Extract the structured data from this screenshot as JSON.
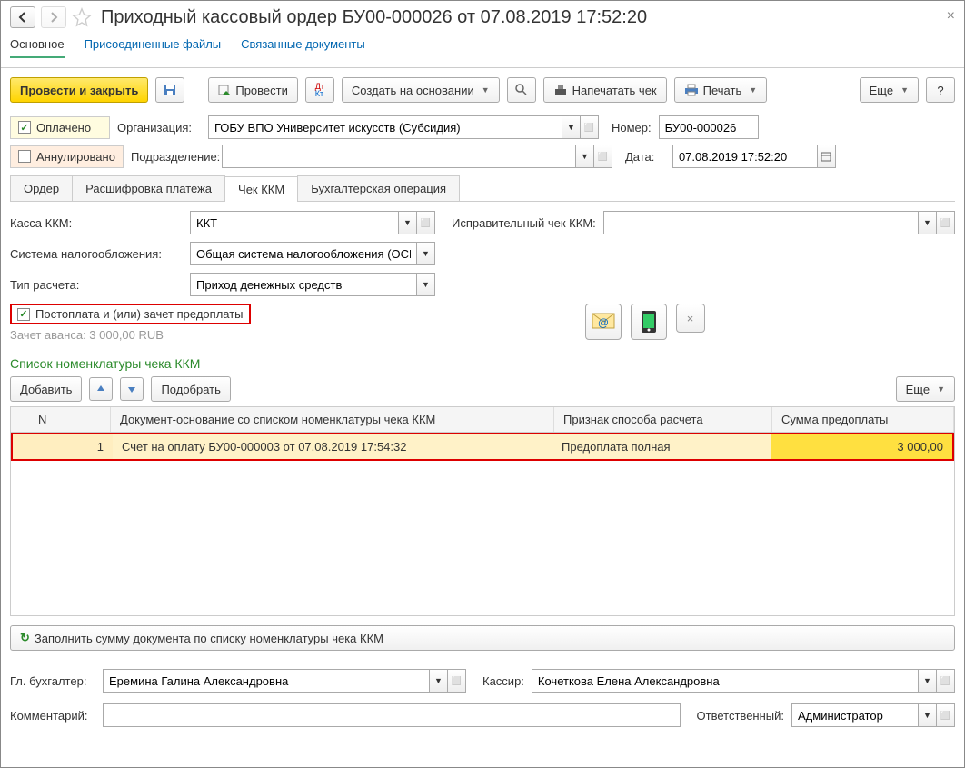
{
  "header": {
    "title": "Приходный кассовый ордер БУ00-000026 от 07.08.2019 17:52:20"
  },
  "linkTabs": {
    "main": "Основное",
    "files": "Присоединенные файлы",
    "related": "Связанные документы"
  },
  "toolbar": {
    "post_close": "Провести и закрыть",
    "post": "Провести",
    "create_based": "Создать на основании",
    "print_check": "Напечатать чек",
    "print": "Печать",
    "more": "Еще",
    "help": "?"
  },
  "statusChecks": {
    "paid": "Оплачено",
    "cancelled": "Аннулировано"
  },
  "fields": {
    "org_label": "Организация:",
    "org_value": "ГОБУ ВПО Университет искусств (Субсидия)",
    "number_label": "Номер:",
    "number_value": "БУ00-000026",
    "dept_label": "Подразделение:",
    "dept_value": "",
    "date_label": "Дата:",
    "date_value": "07.08.2019 17:52:20"
  },
  "subtabs": {
    "order": "Ордер",
    "decode": "Расшифровка платежа",
    "check": "Чек ККМ",
    "accop": "Бухгалтерская операция"
  },
  "checkTab": {
    "kassa_label": "Касса ККМ:",
    "kassa_value": "ККТ",
    "corr_label": "Исправительный чек ККМ:",
    "corr_value": "",
    "tax_label": "Система налогообложения:",
    "tax_value": "Общая система налогообложения (ОСН)",
    "calc_label": "Тип расчета:",
    "calc_value": "Приход денежных средств",
    "postpay_check": "Постоплата и (или) зачет предоплаты",
    "advance_text": "Зачет аванса: 3 000,00 RUB"
  },
  "nomenclature": {
    "title": "Список номенклатуры чека ККМ",
    "add": "Добавить",
    "select": "Подобрать",
    "more": "Еще",
    "columns": {
      "n": "N",
      "doc": "Документ-основание со списком номенклатуры чека ККМ",
      "sign": "Признак способа расчета",
      "sum": "Сумма предоплаты"
    },
    "row1": {
      "n": "1",
      "doc": "Счет на оплату БУ00-000003 от 07.08.2019 17:54:32",
      "sign": "Предоплата полная",
      "sum": "3 000,00"
    },
    "fill_btn": "Заполнить сумму документа по списку номенклатуры чека ККМ"
  },
  "footer": {
    "accountant_label": "Гл. бухгалтер:",
    "accountant_value": "Еремина Галина Александровна",
    "cashier_label": "Кассир:",
    "cashier_value": "Кочеткова Елена Александровна",
    "comment_label": "Комментарий:",
    "comment_value": "",
    "responsible_label": "Ответственный:",
    "responsible_value": "Администратор"
  }
}
